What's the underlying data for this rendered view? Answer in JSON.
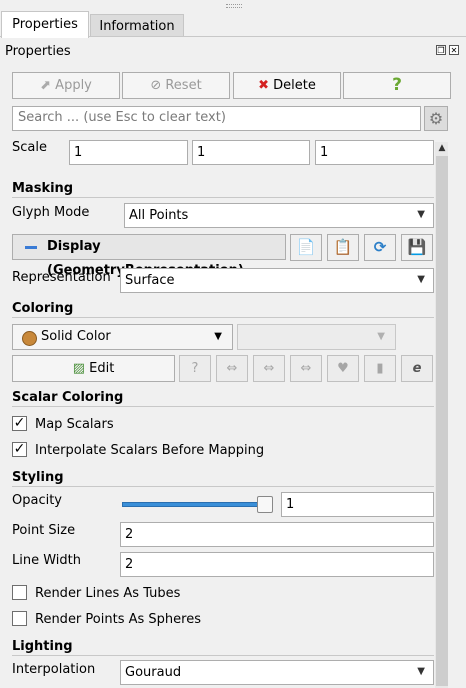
{
  "tabs": [
    {
      "label": "Properties",
      "active": true
    },
    {
      "label": "Information",
      "active": false
    }
  ],
  "panel_title": "Properties",
  "toolbar": {
    "apply": "Apply",
    "reset": "Reset",
    "delete": "Delete",
    "help": "?"
  },
  "search": {
    "placeholder": "Search ... (use Esc to clear text)"
  },
  "scale": {
    "label": "Scale",
    "values": [
      "1",
      "1",
      "1"
    ]
  },
  "masking": {
    "header": "Masking",
    "glyph_mode_label": "Glyph Mode",
    "glyph_mode_value": "All Points"
  },
  "display": {
    "title": "Display (GeometryRepresentation)",
    "representation_label": "Representation",
    "representation_value": "Surface"
  },
  "coloring": {
    "header": "Coloring",
    "mode": "Solid Color",
    "edit": "Edit"
  },
  "scalar_coloring": {
    "header": "Scalar Coloring",
    "map_scalars": "Map Scalars",
    "map_scalars_checked": true,
    "interpolate": "Interpolate Scalars Before Mapping",
    "interpolate_checked": true
  },
  "styling": {
    "header": "Styling",
    "opacity_label": "Opacity",
    "opacity_value": "1",
    "opacity_level": 1.0,
    "point_size_label": "Point Size",
    "point_size_value": "2",
    "line_width_label": "Line Width",
    "line_width_value": "2",
    "tubes_label": "Render Lines As Tubes",
    "tubes_checked": false,
    "spheres_label": "Render Points As Spheres",
    "spheres_checked": false
  },
  "lighting": {
    "header": "Lighting",
    "interpolation_label": "Interpolation",
    "interpolation_value": "Gouraud"
  },
  "colors": {
    "delete_icon": "#d42020",
    "help_icon": "#6aa832",
    "accent": "#3a8fd8",
    "solid_color_swatch": "#c8883a"
  }
}
